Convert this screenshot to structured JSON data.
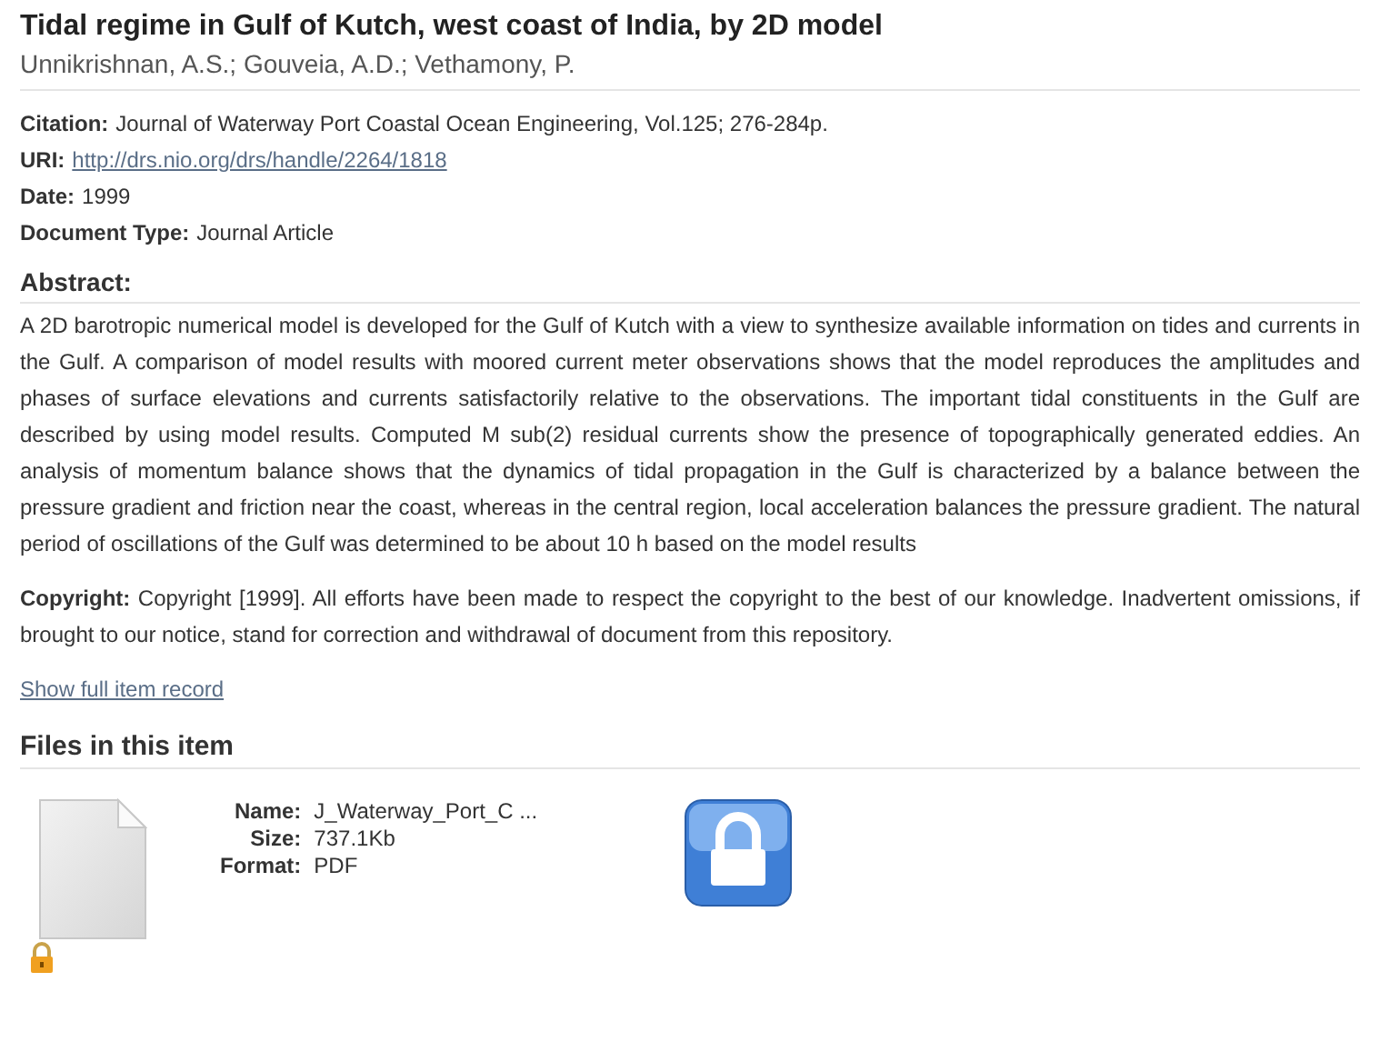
{
  "title": "Tidal regime in Gulf of Kutch, west coast of India, by 2D model",
  "authors": "Unnikrishnan, A.S.; Gouveia, A.D.; Vethamony, P.",
  "fields": [
    {
      "label": "Citation:",
      "value": "Journal of Waterway Port Coastal Ocean Engineering, Vol.125; 276-284p.",
      "kind": "text"
    },
    {
      "label": "URI:",
      "value": "http://drs.nio.org/drs/handle/2264/1818",
      "kind": "link"
    },
    {
      "label": "Date:",
      "value": "1999",
      "kind": "text"
    },
    {
      "label": "Document Type:",
      "value": "Journal Article",
      "kind": "text"
    }
  ],
  "abstract": {
    "heading": "Abstract:",
    "text": "A 2D barotropic numerical model is developed for the Gulf of Kutch with a view to synthesize available information on tides and currents in the Gulf. A comparison of model results with moored current meter observations shows that the model reproduces the amplitudes and phases of surface elevations and currents satisfactorily relative to the observations. The important tidal constituents in the Gulf are described by using model results. Computed M sub(2) residual currents show the presence of topographically generated eddies. An analysis of momentum balance shows that the dynamics of tidal propagation in the Gulf is characterized by a balance between the pressure gradient and friction near the coast, whereas in the central region, local acceleration balances the pressure gradient. The natural period of oscillations of the Gulf was determined to be about 10 h based on the model results"
  },
  "copyright": {
    "label": "Copyright:",
    "text": "Copyright [1999]. All efforts have been made to respect the copyright to the best of our knowledge. Inadvertent omissions, if brought to our notice, stand for correction and withdrawal of document from this repository."
  },
  "full_record_link": "Show full item record",
  "files": {
    "heading": "Files in this item",
    "items": [
      {
        "details": [
          {
            "label": "Name:",
            "value": "J_Waterway_Port_C ..."
          },
          {
            "label": "Size:",
            "value": "737.1Kb"
          },
          {
            "label": "Format:",
            "value": "PDF"
          }
        ],
        "restricted": true
      }
    ]
  }
}
